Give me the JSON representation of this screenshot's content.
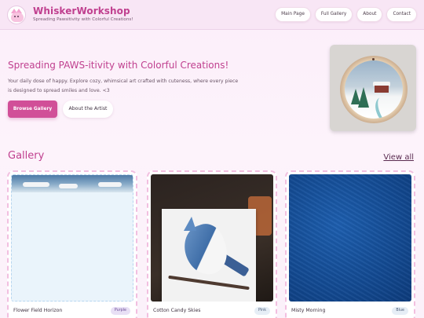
{
  "brand": {
    "title": "WhiskerWorkshop",
    "tagline": "Spreading Pawsitivity with Colorful Creations!"
  },
  "nav": {
    "items": [
      {
        "label": "Main Page"
      },
      {
        "label": "Full Gallery"
      },
      {
        "label": "About"
      },
      {
        "label": "Contact"
      }
    ]
  },
  "hero": {
    "title": "Spreading PAWS-itivity with Colorful Creations!",
    "description": "Your daily dose of happy. Explore cozy, whimsical art crafted with cuteness, where every piece is designed to spread smiles and love. <3",
    "primary_button": "Browse Gallery",
    "secondary_button": "About the Artist"
  },
  "gallery": {
    "title": "Gallery",
    "view_all": "View all",
    "cards": [
      {
        "name": "Flower Field Horizon",
        "tag": "Purple"
      },
      {
        "name": "Cotton Candy Skies",
        "tag": "Pink"
      },
      {
        "name": "Misty Morning",
        "tag": "Blue"
      }
    ]
  },
  "colors": {
    "accent": "#c0408f",
    "primary_button": "#d14f98",
    "background": "#fbeefa"
  }
}
